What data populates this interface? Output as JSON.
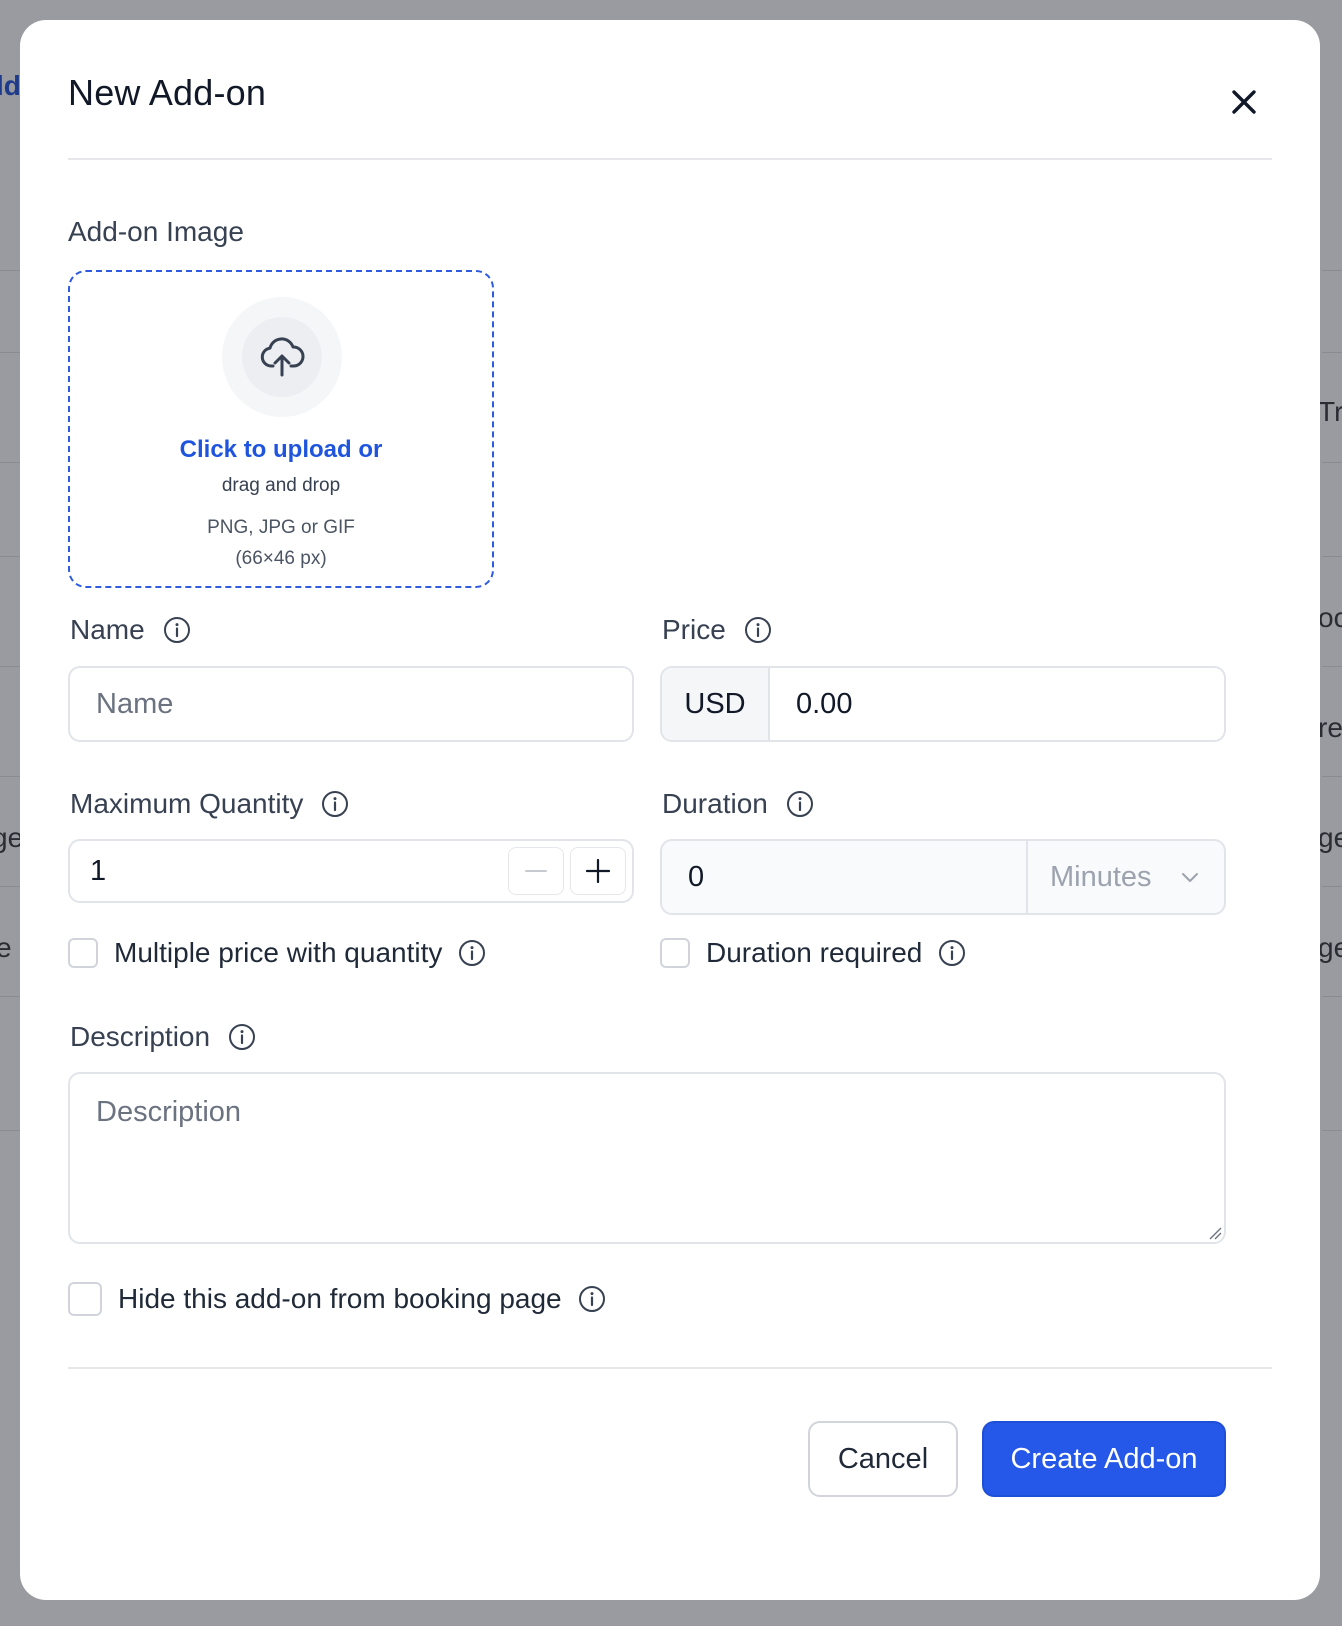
{
  "background": {
    "fragments": [
      "ld",
      "Tr",
      "oc",
      "re",
      "ge",
      "ge",
      "e",
      "ge"
    ]
  },
  "modal": {
    "title": "New Add-on"
  },
  "image": {
    "label": "Add-on Image",
    "upload_link": "Click to upload or",
    "upload_hint": "drag and drop",
    "formats": "PNG, JPG or GIF",
    "dimensions": "(66×46 px)"
  },
  "name": {
    "label": "Name",
    "placeholder": "Name",
    "value": ""
  },
  "price": {
    "label": "Price",
    "currency": "USD",
    "value": "0.00"
  },
  "max_quantity": {
    "label": "Maximum Quantity",
    "value": "1"
  },
  "duration": {
    "label": "Duration",
    "value": "0",
    "unit": "Minutes"
  },
  "checkboxes": {
    "multiple_price": "Multiple price with quantity",
    "duration_required": "Duration required",
    "hide_from_booking": "Hide this add-on from booking page"
  },
  "description": {
    "label": "Description",
    "placeholder": "Description",
    "value": ""
  },
  "footer": {
    "cancel_label": "Cancel",
    "create_label": "Create Add-on"
  },
  "colors": {
    "accent": "#2558e8",
    "link": "#1f55de",
    "overlay": "#8f9096"
  },
  "icons": {
    "close": "close-icon",
    "upload": "cloud-upload-icon",
    "info": "info-icon",
    "minus": "minus-icon",
    "plus": "plus-icon",
    "chevron": "chevron-down-icon"
  }
}
